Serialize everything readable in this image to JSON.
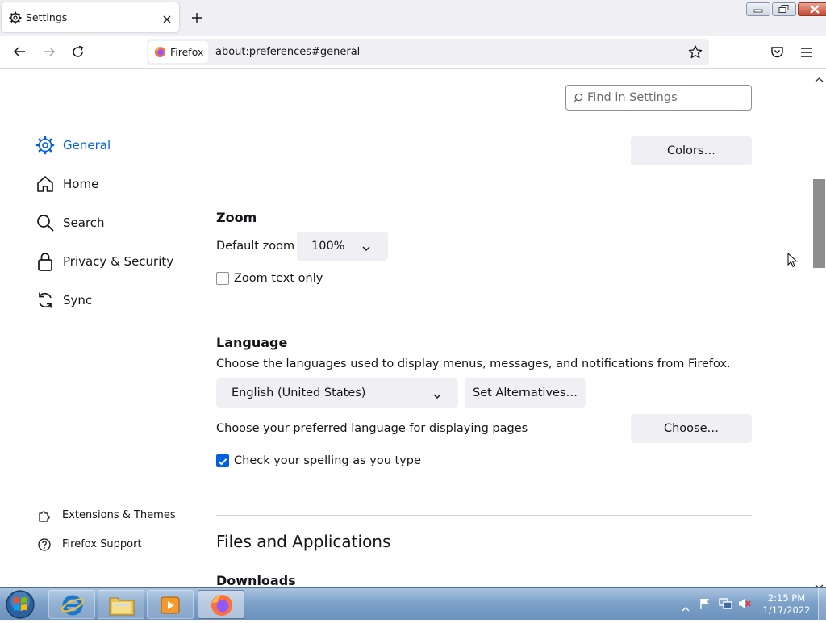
{
  "window": {
    "tab_title": "Settings",
    "new_tab_label": "+"
  },
  "toolbar": {
    "identity_label": "Firefox",
    "url": "about:preferences#general"
  },
  "search": {
    "placeholder": "Find in Settings"
  },
  "sidebar": {
    "items": [
      {
        "label": "General",
        "icon": "gear-icon",
        "active": true
      },
      {
        "label": "Home",
        "icon": "home-icon",
        "active": false
      },
      {
        "label": "Search",
        "icon": "search-icon",
        "active": false
      },
      {
        "label": "Privacy & Security",
        "icon": "lock-icon",
        "active": false
      },
      {
        "label": "Sync",
        "icon": "sync-icon",
        "active": false
      }
    ],
    "footer": [
      {
        "label": "Extensions & Themes",
        "icon": "puzzle-icon"
      },
      {
        "label": "Firefox Support",
        "icon": "help-icon"
      }
    ]
  },
  "main": {
    "colors_button": "Colors…",
    "zoom": {
      "heading": "Zoom",
      "default_label": "Default zoom",
      "default_value": "100%",
      "text_only_label": "Zoom text only",
      "text_only_checked": false
    },
    "language": {
      "heading": "Language",
      "description": "Choose the languages used to display menus, messages, and notifications from Firefox.",
      "selected": "English (United States)",
      "alternatives_button": "Set Alternatives…",
      "pages_label": "Choose your preferred language for displaying pages",
      "choose_button": "Choose…",
      "spelling_label": "Check your spelling as you type",
      "spelling_checked": true
    },
    "files_heading": "Files and Applications",
    "downloads_heading": "Downloads"
  },
  "taskbar": {
    "time": "2:15 PM",
    "date": "1/17/2022"
  },
  "colors": {
    "accent": "#0061e0",
    "button_bg": "#f0f0f4"
  }
}
